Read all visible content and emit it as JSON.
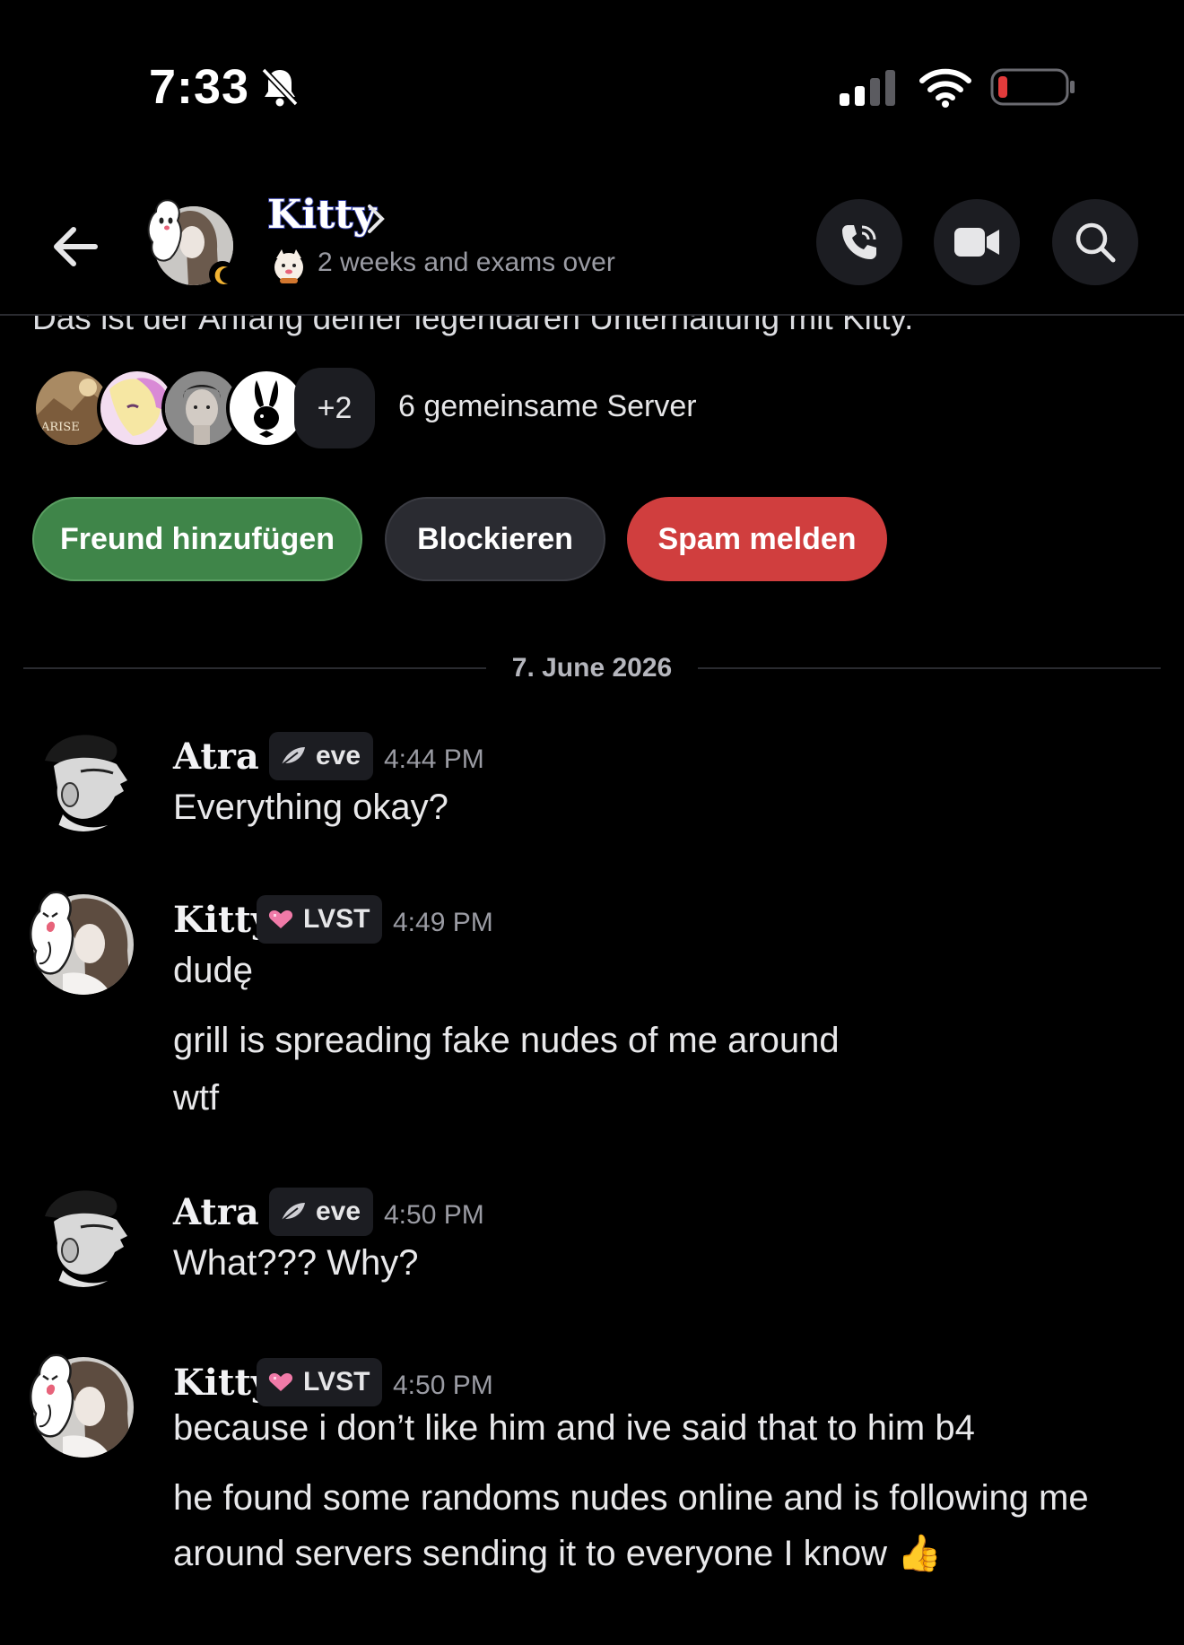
{
  "status_bar": {
    "time": "7:33"
  },
  "header": {
    "name": "Kitty",
    "status": "2 weeks and exams over"
  },
  "intro": "Das ist der Anfang deiner legendären Unterhaltung mit Kitty.",
  "servers": {
    "more": "+2",
    "label": "6 gemeinsame Server",
    "first_icon_text": "ARISE"
  },
  "actions": {
    "add_friend": "Freund hinzufügen",
    "block": "Blockieren",
    "spam": "Spam melden"
  },
  "date_divider": "7. June 2026",
  "messages": [
    {
      "author": "Atra",
      "tag": "eve",
      "time": "4:44 PM",
      "lines": [
        "Everything okay?"
      ]
    },
    {
      "author": "Kitty",
      "tag": "LVST",
      "time": "4:49 PM",
      "lines": [
        "dudę",
        "grill is spreading fake nudes of me around",
        "wtf"
      ]
    },
    {
      "author": "Atra",
      "tag": "eve",
      "time": "4:50 PM",
      "lines": [
        "What??? Why?"
      ]
    },
    {
      "author": "Kitty",
      "tag": "LVST",
      "time": "4:50 PM",
      "lines": [
        "because i don’t like him and ive said that to him b4",
        "he found some randoms nudes online and is following me",
        "around servers sending it to everyone I know 👍"
      ]
    }
  ],
  "colors": {
    "add_friend": "#3f8549",
    "block": "#2a2b31",
    "spam": "#d03e3e",
    "background": "#000000",
    "battery_low": "#e23b3b"
  },
  "icons": [
    "bell-slash-icon",
    "signal-icon",
    "wifi-icon",
    "battery-icon",
    "back-arrow-icon",
    "chevron-right-icon",
    "phone-icon",
    "video-camera-icon",
    "search-icon",
    "heart-icon",
    "feather-icon"
  ]
}
